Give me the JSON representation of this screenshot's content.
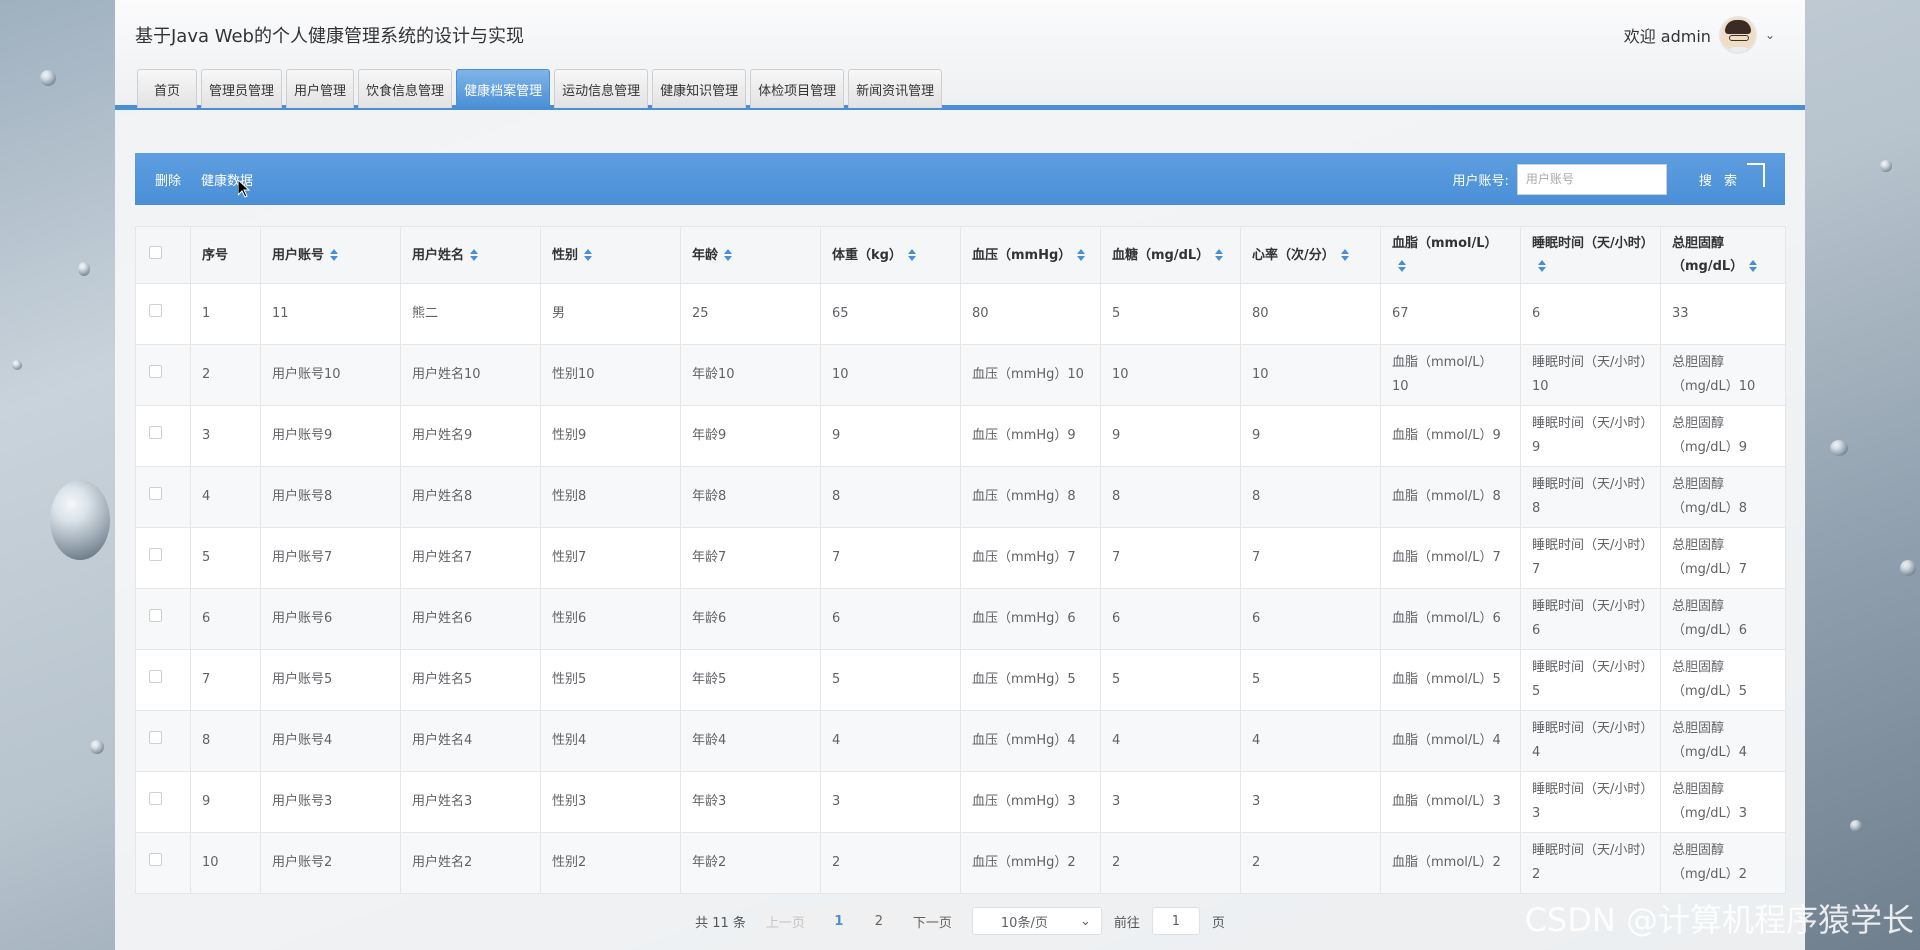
{
  "header": {
    "title": "基于Java Web的个人健康管理系统的设计与实现",
    "welcome": "欢迎 admin"
  },
  "nav": {
    "tabs": [
      "首页",
      "管理员管理",
      "用户管理",
      "饮食信息管理",
      "健康档案管理",
      "运动信息管理",
      "健康知识管理",
      "体检项目管理",
      "新闻资讯管理"
    ],
    "active": "健康档案管理"
  },
  "toolbar": {
    "delete_label": "删除",
    "health_data_label": "健康数据",
    "search_label": "用户账号:",
    "search_placeholder": "用户账号",
    "search_button": "搜 索"
  },
  "table": {
    "headers": [
      "序号",
      "用户账号",
      "用户姓名",
      "性别",
      "年龄",
      "体重（kg）",
      "血压（mmHg）",
      "血糖（mg/dL）",
      "心率（次/分）",
      "血脂（mmol/L）",
      "睡眠时间（天/小时）",
      "总胆固醇（mg/dL）"
    ],
    "sortable": [
      false,
      true,
      true,
      true,
      true,
      true,
      true,
      true,
      true,
      true,
      true,
      true
    ],
    "rows": [
      [
        "1",
        "11",
        "熊二",
        "男",
        "25",
        "65",
        "80",
        "5",
        "80",
        "67",
        "6",
        "33"
      ],
      [
        "2",
        "用户账号10",
        "用户姓名10",
        "性别10",
        "年龄10",
        "10",
        "血压（mmHg）10",
        "10",
        "10",
        "血脂（mmol/L）10",
        "睡眠时间（天/小时）10",
        "总胆固醇（mg/dL）10"
      ],
      [
        "3",
        "用户账号9",
        "用户姓名9",
        "性别9",
        "年龄9",
        "9",
        "血压（mmHg）9",
        "9",
        "9",
        "血脂（mmol/L）9",
        "睡眠时间（天/小时）9",
        "总胆固醇（mg/dL）9"
      ],
      [
        "4",
        "用户账号8",
        "用户姓名8",
        "性别8",
        "年龄8",
        "8",
        "血压（mmHg）8",
        "8",
        "8",
        "血脂（mmol/L）8",
        "睡眠时间（天/小时）8",
        "总胆固醇（mg/dL）8"
      ],
      [
        "5",
        "用户账号7",
        "用户姓名7",
        "性别7",
        "年龄7",
        "7",
        "血压（mmHg）7",
        "7",
        "7",
        "血脂（mmol/L）7",
        "睡眠时间（天/小时）7",
        "总胆固醇（mg/dL）7"
      ],
      [
        "6",
        "用户账号6",
        "用户姓名6",
        "性别6",
        "年龄6",
        "6",
        "血压（mmHg）6",
        "6",
        "6",
        "血脂（mmol/L）6",
        "睡眠时间（天/小时）6",
        "总胆固醇（mg/dL）6"
      ],
      [
        "7",
        "用户账号5",
        "用户姓名5",
        "性别5",
        "年龄5",
        "5",
        "血压（mmHg）5",
        "5",
        "5",
        "血脂（mmol/L）5",
        "睡眠时间（天/小时）5",
        "总胆固醇（mg/dL）5"
      ],
      [
        "8",
        "用户账号4",
        "用户姓名4",
        "性别4",
        "年龄4",
        "4",
        "血压（mmHg）4",
        "4",
        "4",
        "血脂（mmol/L）4",
        "睡眠时间（天/小时）4",
        "总胆固醇（mg/dL）4"
      ],
      [
        "9",
        "用户账号3",
        "用户姓名3",
        "性别3",
        "年龄3",
        "3",
        "血压（mmHg）3",
        "3",
        "3",
        "血脂（mmol/L）3",
        "睡眠时间（天/小时）3",
        "总胆固醇（mg/dL）3"
      ],
      [
        "10",
        "用户账号2",
        "用户姓名2",
        "性别2",
        "年龄2",
        "2",
        "血压（mmHg）2",
        "2",
        "2",
        "血脂（mmol/L）2",
        "睡眠时间（天/小时）2",
        "总胆固醇（mg/dL）2"
      ]
    ]
  },
  "pager": {
    "total": "共 11 条",
    "prev": "上一页",
    "pages": [
      "1",
      "2"
    ],
    "current": "1",
    "next": "下一页",
    "page_size": "10条/页",
    "goto_label": "前往",
    "goto_value": "1",
    "page_suffix": "页"
  },
  "watermark": "CSDN @计算机程序猿学长",
  "colors": {
    "accent": "#4a8fd6",
    "toolbar": "#5e9ee0"
  }
}
